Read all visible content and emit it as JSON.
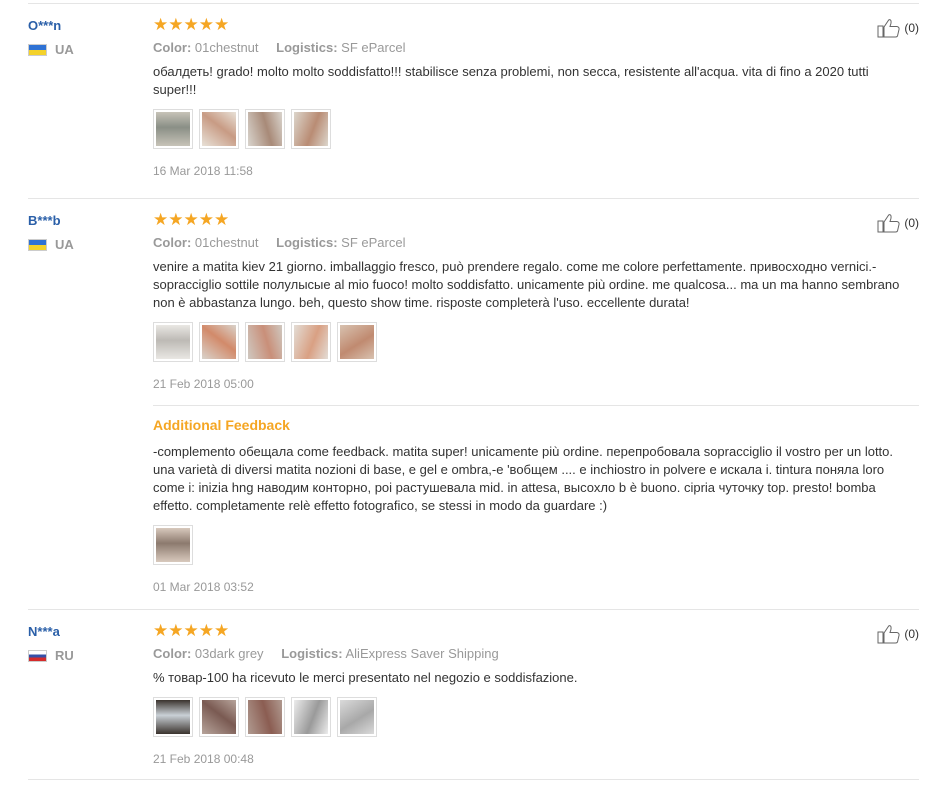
{
  "labels": {
    "color": "Color:",
    "logistics": "Logistics:",
    "additional_feedback": "Additional Feedback"
  },
  "rating_stars": "★★★★★",
  "reviews": [
    {
      "user": "O***n",
      "country": "UA",
      "flag": "ua",
      "rating": 5,
      "color": "01chestnut",
      "logistics": "SF eParcel",
      "text": "обалдеть! grado! molto molto soddisfatto!!! stabilisce senza problemi, non secca, resistente all'acqua. vita di fino a 2020 tutti super!!!",
      "helpful": "(0)",
      "photos": [
        {
          "fg": "#8a8f86",
          "bg": "#c7c3b8"
        },
        {
          "fg": "#c89b84",
          "bg": "#e8e1d7"
        },
        {
          "fg": "#a88a78",
          "bg": "#d9d4cd"
        },
        {
          "fg": "#b98c74",
          "bg": "#dcd6cc"
        }
      ],
      "date": "16 Mar 2018 11:58"
    },
    {
      "user": "B***b",
      "country": "UA",
      "flag": "ua",
      "rating": 5,
      "color": "01chestnut",
      "logistics": "SF eParcel",
      "text": "venire a matita kiev 21 giorno. imballaggio fresco, può prendere regalo. come me colore perfettamente. привосходно vernici.- sopracciglio sottile полулысые al mio fuoco! molto soddisfatto. unicamente più ordine. me qualcosa... ma un ma hanno sembrano non è abbastanza lungo. beh, questo show time. risposte completerà l'uso. eccellente durata!",
      "helpful": "(0)",
      "photos": [
        {
          "fg": "#bdbab5",
          "bg": "#e9e7e3"
        },
        {
          "fg": "#d28a6a",
          "bg": "#d9d3cb"
        },
        {
          "fg": "#c98f79",
          "bg": "#cfc8c0"
        },
        {
          "fg": "#d9a083",
          "bg": "#e3ddd6"
        },
        {
          "fg": "#c08a70",
          "bg": "#d8c2b0"
        }
      ],
      "date": "21 Feb 2018 05:00",
      "additional": {
        "text": "-complemento обещала come feedback. matita super! unicamente più ordine. перепробовала sopracciglio il vostro per un lotto. una varietà di diversi matita nozioni di base, e gel e ombra,-e 'вобщем .... e inchiostro in polvere e искала i. tintura поняла loro come i: inizia hng наводим конторно, poi растушевала mid. in attesa, высохло b è buono. cipria чуточку top. presto! bomba effetto. completamente relè effetto fotografico, se stessi in modo da guardare :)",
        "photos": [
          {
            "fg": "#8c7a6e",
            "bg": "#d8c9bd"
          }
        ],
        "date": "01 Mar 2018 03:52"
      }
    },
    {
      "user": "N***a",
      "country": "RU",
      "flag": "ru",
      "rating": 5,
      "color": "03dark grey",
      "logistics": "AliExpress Saver Shipping",
      "text": "% товар-100 ha ricevuto le merci presentato nel negozio e soddisfazione.",
      "helpful": "(0)",
      "photos": [
        {
          "fg": "#c9d0d6",
          "bg": "#3a332e"
        },
        {
          "fg": "#7a5a52",
          "bg": "#b7a49b"
        },
        {
          "fg": "#8b5d52",
          "bg": "#b09a90"
        },
        {
          "fg": "#9a9a9a",
          "bg": "#ececec"
        },
        {
          "fg": "#a8a8a8",
          "bg": "#dadada"
        }
      ],
      "date": "21 Feb 2018 00:48"
    }
  ]
}
